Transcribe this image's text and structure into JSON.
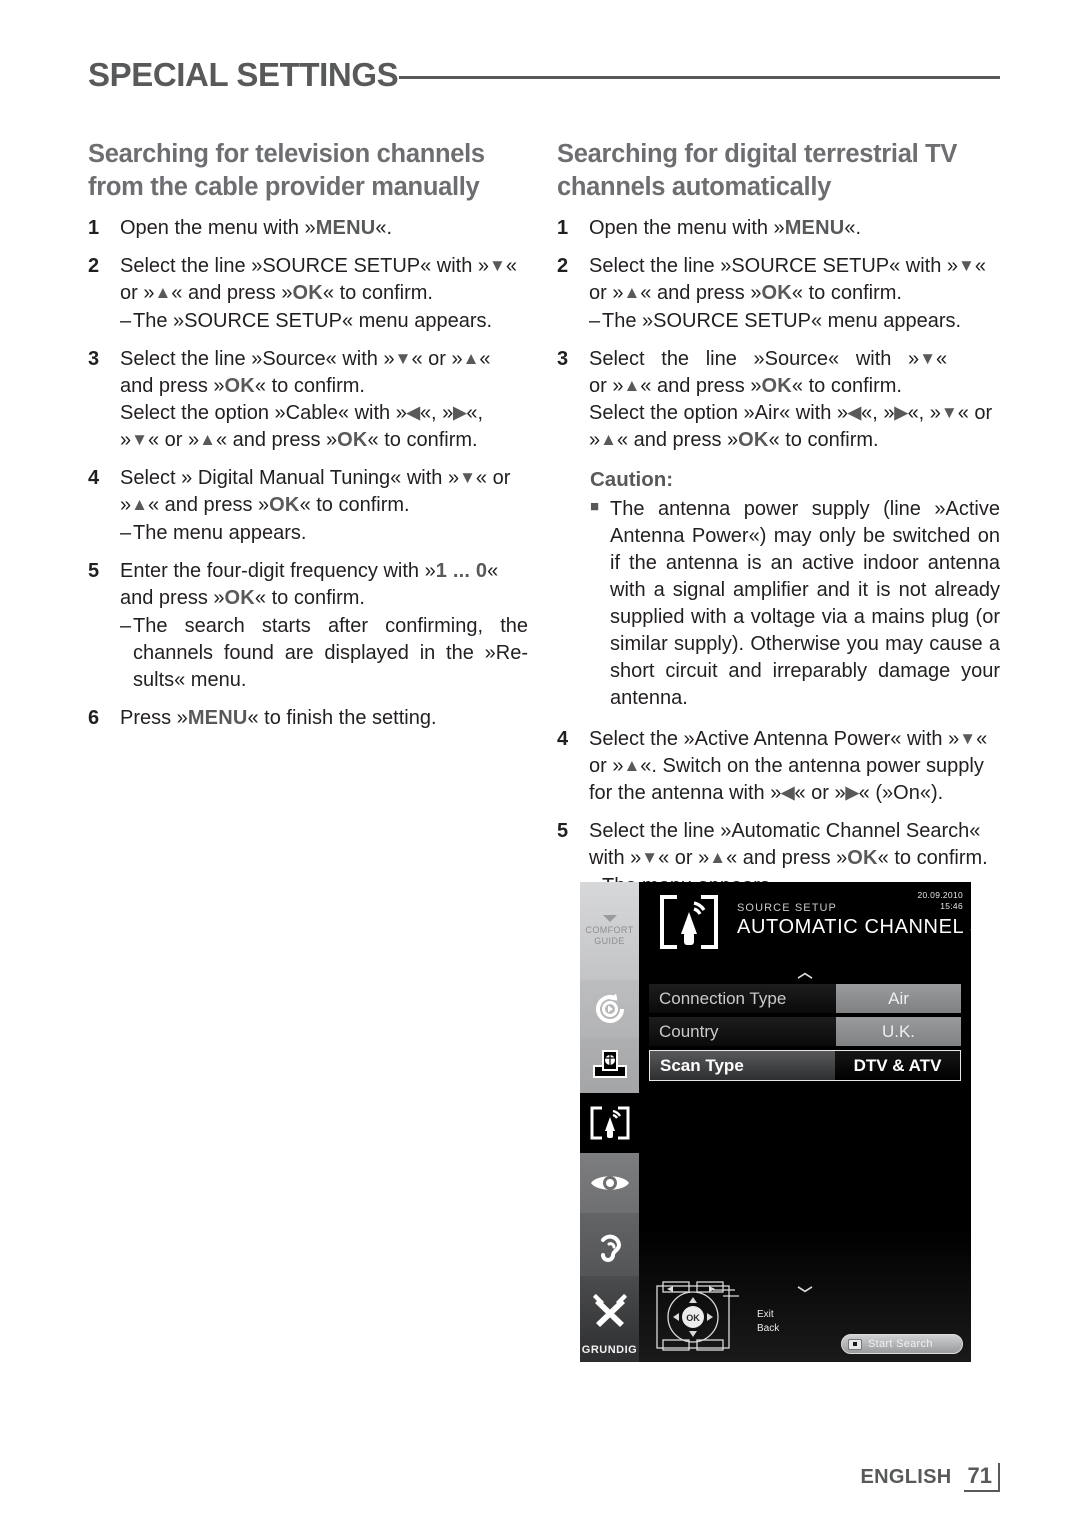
{
  "header": {
    "title": "SPECIAL SETTINGS"
  },
  "left_column": {
    "heading": "Searching for television channels from the cable provider manually",
    "steps": [
      {
        "num": "1",
        "lines": [
          "Open the menu with »MENU«."
        ]
      },
      {
        "num": "2",
        "lines": [
          "Select the line »SOURCE SETUP« with »∨« or »∧« and press »OK« to confirm."
        ],
        "dash": "The »SOURCE SETUP« menu appears."
      },
      {
        "num": "3",
        "lines": [
          "Select the line »Source« with »∨« or »∧« and press »OK« to confirm.",
          "Select the option »Cable« with »<«, »>«, »∨« or »∧« and press »OK« to confirm."
        ]
      },
      {
        "num": "4",
        "lines": [
          "Select » Digital Manual Tuning« with »∨« or »∧« and press »OK« to confirm."
        ],
        "dash": "The menu appears."
      },
      {
        "num": "5",
        "lines": [
          "Enter the four-digit frequency with »1 ... 0« and press »OK« to confirm."
        ],
        "dash": "The search starts after confirming, the channels found are displayed in the »Results« menu."
      },
      {
        "num": "6",
        "lines": [
          "Press »MENU« to finish the setting."
        ]
      }
    ]
  },
  "right_column": {
    "heading": "Searching for digital terrestrial TV channels automatically",
    "steps": [
      {
        "num": "1",
        "lines": [
          "Open the menu with »MENU«."
        ]
      },
      {
        "num": "2",
        "lines": [
          "Select the line »SOURCE SETUP« with »∨« or »∧« and press »OK« to confirm."
        ],
        "dash": "The »SOURCE SETUP« menu appears."
      },
      {
        "num": "3",
        "lines": [
          "Select the line »Source« with »∨« or »∧« and press »OK« to confirm.",
          "Select the option »Air« with »<«, »>«, »∨« or »∧« and press »OK« to confirm."
        ]
      }
    ],
    "caution": {
      "heading": "Caution:",
      "bullet": "■",
      "text": "The antenna power supply (line »Active Antenna Power«) may only be switched on if the antenna is an active indoor antenna with a signal amplifier and it is not already supplied with a voltage via a mains plug (or similar supply). Otherwise you may cause a short circuit and irreparably damage your antenna."
    },
    "steps_after": [
      {
        "num": "4",
        "lines": [
          "Select the »Active Antenna Power« with »∨« or »∧«. Switch on the antenna power supply for the antenna with »<« or »>« (»On«)."
        ]
      },
      {
        "num": "5",
        "lines": [
          "Select the line »Automatic Channel Search« with »∨« or »∧« and press »OK« to confirm."
        ],
        "dash": "The menu appears."
      }
    ]
  },
  "tv_screenshot": {
    "sidebar": {
      "comfort_label_line1": "COMFORT",
      "comfort_label_line2": "GUIDE",
      "brand": "GRUNDIG",
      "items": [
        {
          "name": "media-play-icon"
        },
        {
          "name": "network-globe-icon"
        },
        {
          "name": "antenna-source-icon",
          "selected": true
        },
        {
          "name": "eye-picture-icon"
        },
        {
          "name": "ear-sound-icon"
        },
        {
          "name": "tools-settings-icon"
        }
      ]
    },
    "osd": {
      "breadcrumb": "SOURCE SETUP",
      "title": "AUTOMATIC CHANNEL SEARCH",
      "date": "20.09.2010",
      "time": "15:46",
      "rows": [
        {
          "label": "Connection Type",
          "value": "Air",
          "selected": false
        },
        {
          "label": "Country",
          "value": "U.K.",
          "selected": false
        },
        {
          "label": "Scan Type",
          "value": "DTV & ATV",
          "selected": true
        }
      ],
      "key_hints": [
        "Exit",
        "Back"
      ],
      "ok_label": "OK",
      "start_button": "Start Search"
    }
  },
  "footer": {
    "language": "ENGLISH",
    "page": "71"
  },
  "colors": {
    "heading_gray": "#6d6e71",
    "rule_gray": "#58595b",
    "body_black": "#231f20"
  }
}
